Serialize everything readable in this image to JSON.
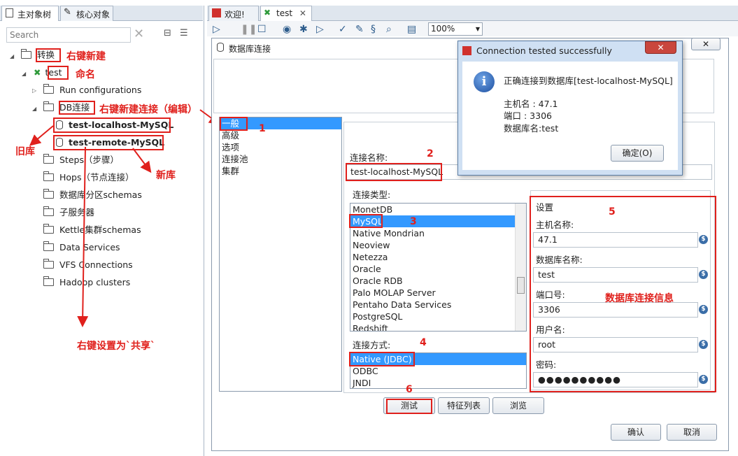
{
  "left_panel": {
    "tabs": [
      "主对象树",
      "核心对象"
    ],
    "search_placeholder": "Search",
    "tree": {
      "transform": "转换",
      "test": "test",
      "run_configs": "Run configurations",
      "db_connections": "DB连接",
      "db_local": "test-localhost-MySQL",
      "db_remote": "test-remote-MySQL",
      "steps": "Steps（步骤）",
      "hops": "Hops（节点连接）",
      "partitions": "数据库分区schemas",
      "slave": "子服务器",
      "kettle_cluster": "Kettle集群schemas",
      "data_services": "Data Services",
      "vfs": "VFS Connections",
      "hadoop": "Hadoop clusters"
    }
  },
  "editor_tabs": [
    "欢迎!",
    "test"
  ],
  "zoom": "100%",
  "db_dialog": {
    "title": "数据库连接",
    "categories": [
      "一般",
      "高级",
      "选项",
      "连接池",
      "集群"
    ],
    "conn_name_label": "连接名称:",
    "conn_name_value": "test-localhost-MySQL",
    "conn_type_label": "连接类型:",
    "conn_types": [
      "MonetDB",
      "MySQL",
      "Native Mondrian",
      "Neoview",
      "Netezza",
      "Oracle",
      "Oracle RDB",
      "Palo MOLAP Server",
      "Pentaho Data Services",
      "PostgreSQL",
      "Redshift"
    ],
    "access_label": "连接方式:",
    "access_methods": [
      "Native (JDBC)",
      "ODBC",
      "JNDI"
    ],
    "settings_label": "设置",
    "host_label": "主机名称:",
    "host_value": "47.1",
    "dbname_label": "数据库名称:",
    "dbname_value": "test",
    "port_label": "端口号:",
    "port_value": "3306",
    "user_label": "用户名:",
    "user_value": "root",
    "password_label": "密码:",
    "password_value": "●●●●●●●●●●",
    "test_button": "测试",
    "features_button": "特征列表",
    "browse_button": "浏览",
    "ok_button": "确认",
    "cancel_button": "取消"
  },
  "popup": {
    "title": "Connection tested successfully",
    "message": "正确连接到数据库[test-localhost-MySQL]",
    "host_line": "主机名       : 47.1",
    "port_line": "端口           : 3306",
    "db_line": "数据库名:test",
    "ok_button": "确定(O)"
  },
  "annotations": {
    "right_click_new": "右键新建",
    "name": "命名",
    "right_click_new_conn": "右键新建连接（编辑）",
    "old_db": "旧库",
    "new_db": "新库",
    "share": "右键设置为`共享`",
    "n1": "1",
    "n2": "2",
    "n3": "3",
    "n4": "4",
    "n5": "5",
    "n6": "6",
    "conn_info": "数据库连接信息"
  }
}
